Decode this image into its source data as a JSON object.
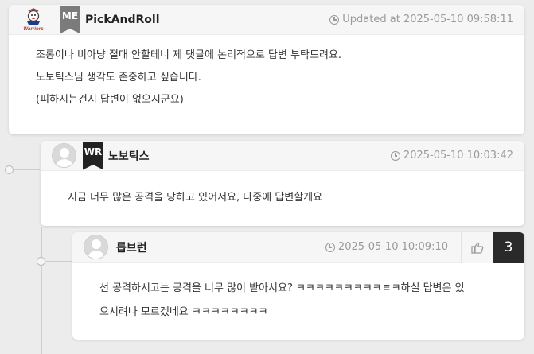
{
  "comments": [
    {
      "username": "PickAndRoll",
      "badge": "ME",
      "avatar_text": "Warriors",
      "timestamp": "Updated at 2025-05-10 09:58:11",
      "lines": [
        "조롱이나 비아냥 절대 안할테니 제 댓글에 논리적으로 답변 부탁드려요.",
        "노보틱스님 생각도 존중하고 싶습니다.",
        "(피하시는건지 답변이 없으시군요)"
      ]
    },
    {
      "username": "노보틱스",
      "badge": "WR",
      "timestamp": "2025-05-10 10:03:42",
      "lines": [
        "지금 너무 많은 공격을 당하고 있어서요, 나중에 답변할게요"
      ]
    },
    {
      "username": "릅브런",
      "timestamp": "2025-05-10 10:09:10",
      "like_count": "3",
      "lines": [
        "선 공격하시고는 공격을 너무 많이 받아서요? ㅋㅋㅋㅋㅋㅋㅋㅋㅋㅌㅋ하실 답변은 있",
        "으시려나 모르겠네요 ㅋㅋㅋㅋㅋㅋㅋㅋ"
      ]
    }
  ]
}
